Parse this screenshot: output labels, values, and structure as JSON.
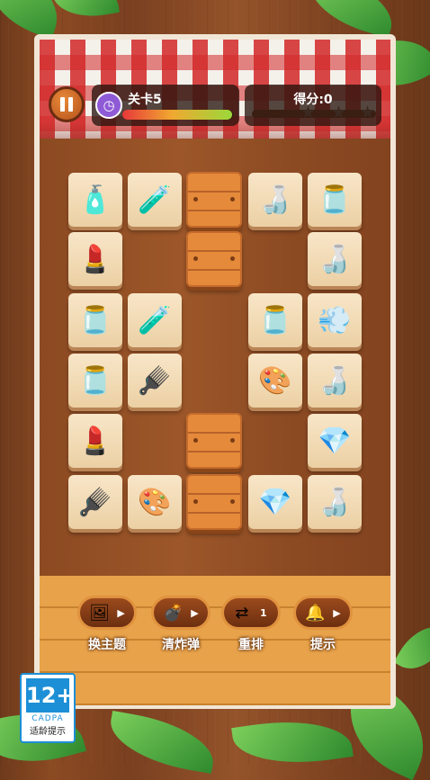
{
  "header": {
    "level_label": "关卡5",
    "level_progress": 0.98,
    "score_label": "得分:0",
    "stars_earned": 0,
    "stars_total": 3
  },
  "board": {
    "rows": [
      [
        "perfume-bottle-icon",
        "serum-dropper-icon",
        "wooden-plank",
        "foundation-bottle-icon",
        "cream-jar-icon"
      ],
      [
        "lipstick-icon",
        "",
        "wooden-plank",
        "",
        "foundation-bottle-icon"
      ],
      [
        "cream-jar-icon",
        "serum-dropper-icon",
        "",
        "cream-jar-icon",
        "hair-dryer-icon"
      ],
      [
        "cream-jar-icon",
        "hair-brush-icon",
        "",
        "compact-powder-icon",
        "foundation-bottle-icon"
      ],
      [
        "lipstick-icon",
        "",
        "wooden-plank",
        "",
        "cologne-bottle-icon"
      ],
      [
        "hair-brush-icon",
        "compact-powder-icon",
        "wooden-plank",
        "cologne-bottle-icon",
        "foundation-bottle-icon"
      ]
    ],
    "glyphs": {
      "perfume-bottle-icon": "🧴",
      "serum-dropper-icon": "🧪",
      "foundation-bottle-icon": "🍶",
      "cream-jar-icon": "🫙",
      "lipstick-icon": "💄",
      "hair-dryer-icon": "💨",
      "hair-brush-icon": "🪮",
      "compact-powder-icon": "🎨",
      "cologne-bottle-icon": "💎"
    }
  },
  "tools": [
    {
      "label": "换主题",
      "icon": "picture-icon",
      "glyph": "🖼",
      "extra": "▶"
    },
    {
      "label": "清炸弹",
      "icon": "bomb-icon",
      "glyph": "💣",
      "extra": "▶"
    },
    {
      "label": "重排",
      "icon": "shuffle-icon",
      "glyph": "⇄",
      "extra": "1"
    },
    {
      "label": "提示",
      "icon": "bell-icon",
      "glyph": "🔔",
      "extra": "▶"
    }
  ],
  "age_rating": {
    "number": "12+",
    "org": "CADPA",
    "tip": "适龄提示"
  }
}
